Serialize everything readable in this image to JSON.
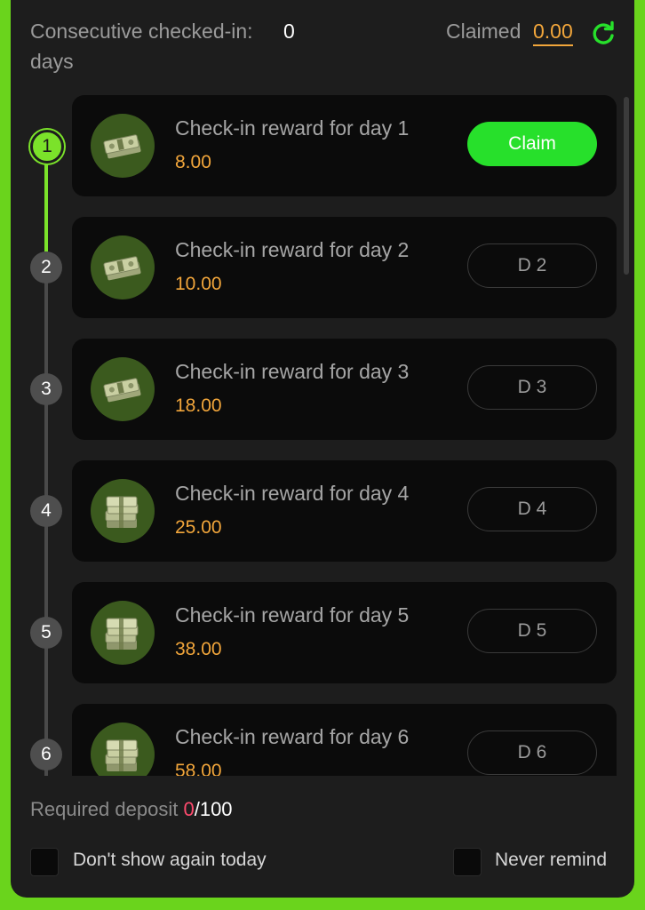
{
  "header": {
    "consecutive_label": "Consecutive checked-in:",
    "consecutive_value": "0",
    "consecutive_unit": "days",
    "claimed_label": "Claimed",
    "claimed_value": "0.00",
    "refresh_icon": "refresh-icon"
  },
  "rewards": [
    {
      "step": "1",
      "title": "Check-in reward for day 1",
      "amount": "8.00",
      "button": "Claim",
      "state": "claimable",
      "icon": "cash-bundle-icon"
    },
    {
      "step": "2",
      "title": "Check-in reward for day 2",
      "amount": "10.00",
      "button": "D 2",
      "state": "locked",
      "icon": "cash-bundle-icon"
    },
    {
      "step": "3",
      "title": "Check-in reward for day 3",
      "amount": "18.00",
      "button": "D 3",
      "state": "locked",
      "icon": "cash-bundle-icon"
    },
    {
      "step": "4",
      "title": "Check-in reward for day 4",
      "amount": "25.00",
      "button": "D 4",
      "state": "locked",
      "icon": "cash-stack-icon"
    },
    {
      "step": "5",
      "title": "Check-in reward for day 5",
      "amount": "38.00",
      "button": "D 5",
      "state": "locked",
      "icon": "cash-stack-icon"
    },
    {
      "step": "6",
      "title": "Check-in reward for day 6",
      "amount": "58.00",
      "button": "D 6",
      "state": "locked",
      "icon": "cash-stack-icon"
    }
  ],
  "footer": {
    "deposit_label": "Required deposit",
    "deposit_current": "0",
    "deposit_total": "/100",
    "dont_show_today": "Don't show again today",
    "never_remind": "Never remind"
  },
  "colors": {
    "accent_green": "#27e02b",
    "timeline_green": "#7be22a",
    "amount_orange": "#f2a63b",
    "deposit_red": "#ff4b6e",
    "panel_bg": "#1d1d1d",
    "card_bg": "#0b0b0b",
    "frame_green": "#6ad41c"
  }
}
